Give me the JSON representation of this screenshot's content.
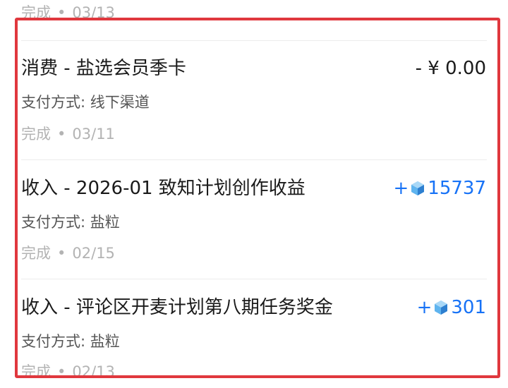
{
  "top_item": {
    "status": "完成",
    "date": "03/13"
  },
  "items": [
    {
      "title": "消费 - 盐选会员季卡",
      "amount": "- ¥ 0.00",
      "payment": "支付方式: 线下渠道",
      "status": "完成",
      "date": "03/11"
    },
    {
      "title": "收入 - 2026-01 致知计划创作收益",
      "amount_sign": "+",
      "amount_value": "15737",
      "payment": "支付方式: 盐粒",
      "status": "完成",
      "date": "02/15"
    },
    {
      "title": "收入 - 评论区开麦计划第八期任务奖金",
      "amount_sign": "+",
      "amount_value": "301",
      "payment": "支付方式: 盐粒",
      "status": "完成",
      "date": "02/13"
    }
  ],
  "separator": "•",
  "icons": {
    "currency": "salt-gem-icon"
  },
  "colors": {
    "positive_amount": "#1772f6",
    "highlight_border": "#e0383e"
  }
}
